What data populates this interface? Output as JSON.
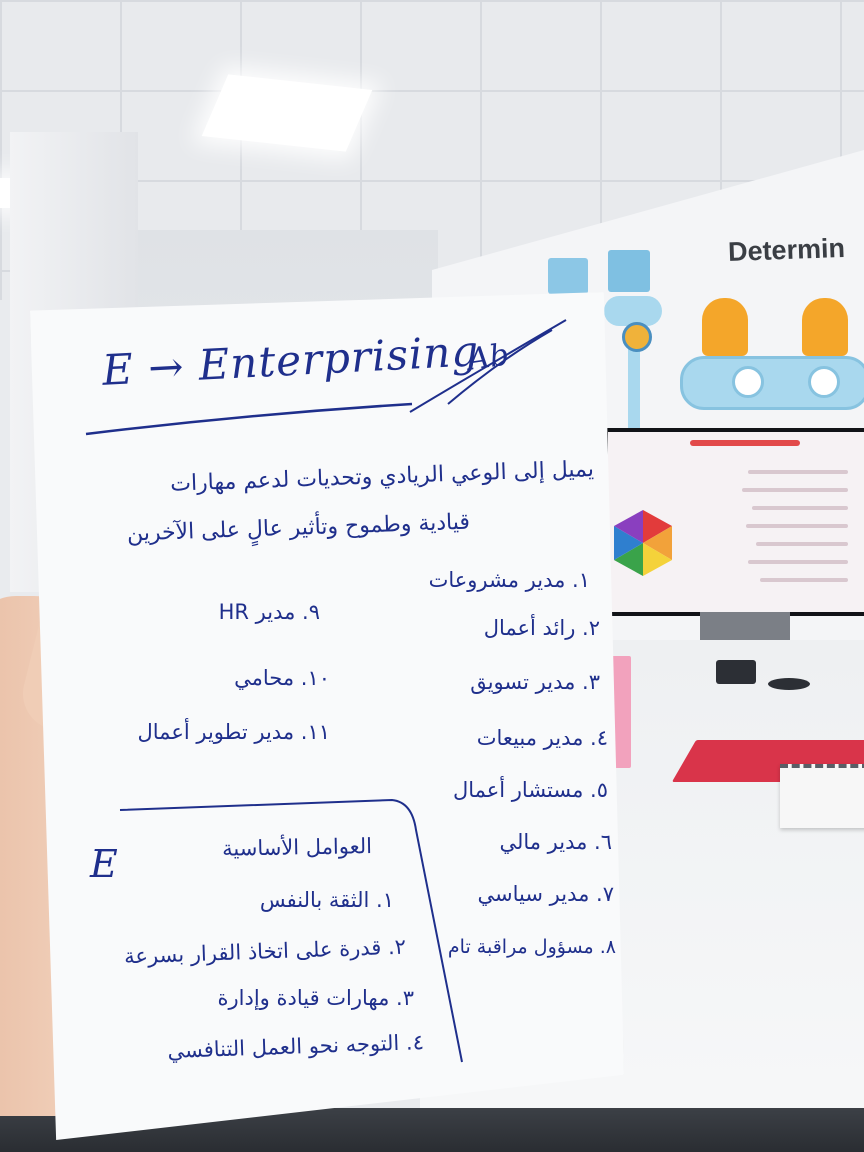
{
  "wall_sign": {
    "text": "Determin"
  },
  "note": {
    "heading": "E → Enterprising",
    "scribble": "Ab",
    "description": [
      "يميل إلى الوعي الريادي وتحديات لدعم مهارات",
      "قيادية وطموح وتأثير عالٍ على الآخرين"
    ],
    "careers_right": [
      "١. مدير مشروعات",
      "٢. رائد أعمال",
      "٣. مدير تسويق",
      "٤. مدير مبيعات",
      "٥. مستشار أعمال",
      "٦. مدير مالي",
      "٧. مدير سياسي",
      "٨. مسؤول مراقبة تام"
    ],
    "careers_left": [
      "٩. مدير HR",
      "١٠. محامي",
      "١١. مدير تطوير أعمال"
    ],
    "box": {
      "letter": "E",
      "title": "العوامل الأساسية",
      "items": [
        "١. الثقة بالنفس",
        "٢. قدرة على اتخاذ القرار بسرعة",
        "٣. مهارات قيادة وإدارة",
        "٤. التوجه نحو العمل التنافسي"
      ]
    }
  },
  "colors": {
    "ink": "#1f2f8c",
    "paper": "#f9fafb",
    "accent_orange": "#f4a62a",
    "accent_blue": "#a9d8ee"
  }
}
